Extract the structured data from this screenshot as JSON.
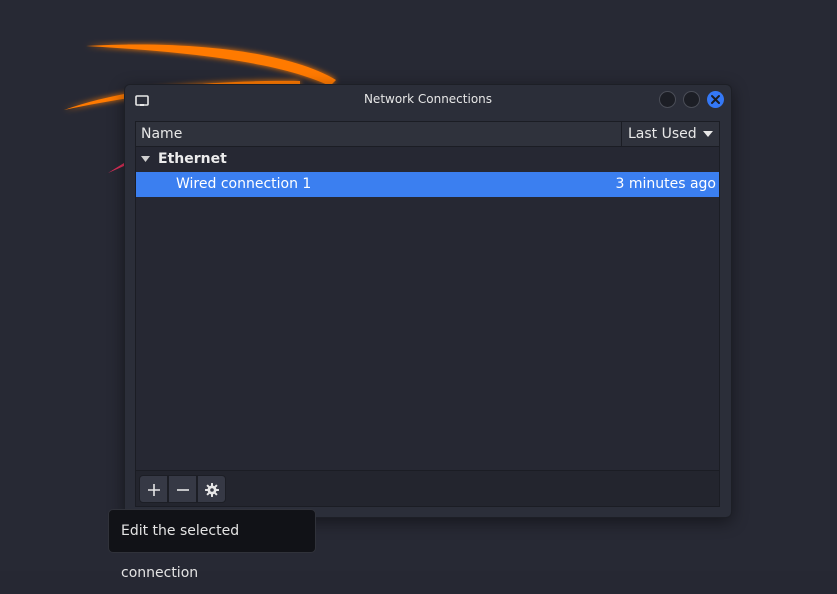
{
  "window": {
    "title": "Network Connections"
  },
  "icons": {
    "app": "network-icon",
    "minimize": "minimize-icon",
    "maximize": "maximize-icon",
    "close": "close-icon",
    "add": "plus-icon",
    "remove": "minus-icon",
    "settings": "gear-icon",
    "sort": "chevron-down-icon",
    "expander": "triangle-down-icon"
  },
  "table": {
    "columns": [
      "Name",
      "Last Used"
    ],
    "groups": [
      {
        "label": "Ethernet",
        "connections": [
          {
            "name": "Wired connection 1",
            "last_used": "3 minutes ago",
            "selected": true
          }
        ]
      }
    ]
  },
  "tooltip": {
    "text": "Edit the selected connection"
  },
  "colors": {
    "accent": "#3b7ff0",
    "background": "#262833",
    "close_button": "#3478f6",
    "wallpaper_swoosh": "#ff7a00"
  }
}
